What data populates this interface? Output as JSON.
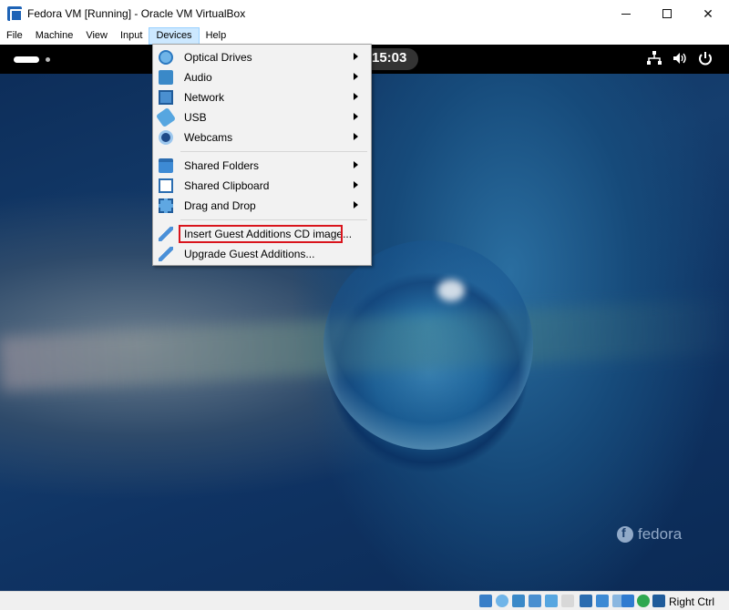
{
  "window": {
    "title": "Fedora VM [Running] - Oracle VM VirtualBox"
  },
  "menubar": {
    "items": [
      "File",
      "Machine",
      "View",
      "Input",
      "Devices",
      "Help"
    ],
    "active": "Devices"
  },
  "guest": {
    "clock": "15:03",
    "watermark": "fedora"
  },
  "devices_menu": {
    "items": [
      {
        "label": "Optical Drives",
        "icon": "optical-disc-icon",
        "submenu": true
      },
      {
        "label": "Audio",
        "icon": "audio-icon",
        "submenu": true
      },
      {
        "label": "Network",
        "icon": "network-icon",
        "submenu": true
      },
      {
        "label": "USB",
        "icon": "usb-icon",
        "submenu": true
      },
      {
        "label": "Webcams",
        "icon": "webcam-icon",
        "submenu": true
      },
      {
        "label": "Shared Folders",
        "icon": "shared-folder-icon",
        "submenu": true
      },
      {
        "label": "Shared Clipboard",
        "icon": "clipboard-icon",
        "submenu": true
      },
      {
        "label": "Drag and Drop",
        "icon": "drag-drop-icon",
        "submenu": true
      },
      {
        "label": "Insert Guest Additions CD image...",
        "icon": "guest-additions-icon",
        "submenu": false,
        "highlighted": true
      },
      {
        "label": "Upgrade Guest Additions...",
        "icon": "guest-additions-icon",
        "submenu": false
      }
    ]
  },
  "statusbar": {
    "host_key": "Right Ctrl"
  },
  "colors": {
    "highlight_border": "#d9141c",
    "menu_active_bg": "#cce8ff",
    "gnome_panel": "#000000"
  }
}
